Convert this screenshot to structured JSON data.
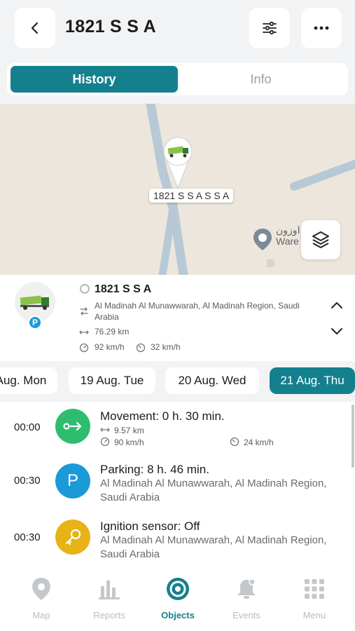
{
  "header": {
    "title": "1821 S S A",
    "back_icon": "chevron-left-icon",
    "filter_icon": "sliders-icon",
    "more_icon": "more-horizontal-icon"
  },
  "tabs": [
    {
      "label": "History",
      "active": true
    },
    {
      "label": "Info",
      "active": false
    }
  ],
  "map": {
    "marker_label": "1821 S S A  S S A",
    "poi_text_line1": "اوزون",
    "poi_text_line2": "Ware",
    "layers_icon": "layers-icon"
  },
  "object_card": {
    "name": "1821 S S A",
    "address": "Al Madinah Al Munawwarah, Al Madinah Region, Saudi Arabia",
    "distance": "76.29 km",
    "max_speed": "92 km/h",
    "avg_speed": "32 km/h",
    "badge": "P"
  },
  "dates": [
    {
      "label": "Aug. Mon",
      "active": false
    },
    {
      "label": "19 Aug. Tue",
      "active": false
    },
    {
      "label": "20 Aug. Wed",
      "active": false
    },
    {
      "label": "21 Aug. Thu",
      "active": true
    }
  ],
  "events": [
    {
      "time": "00:00",
      "title": "Movement: 0 h. 30 min.",
      "distance": "9.57 km",
      "max_speed": "90 km/h",
      "avg_speed": "24 km/h",
      "icon": "movement-icon",
      "color": "#2ebd6e"
    },
    {
      "time": "00:30",
      "title": "Parking: 8 h. 46 min.",
      "address": "Al Madinah Al Munawwarah, Al Madinah Region, Saudi Arabia",
      "icon_text": "P",
      "icon": "parking-icon",
      "color": "#1b9ad8"
    },
    {
      "time": "00:30",
      "title": "Ignition sensor: Off",
      "address": "Al Madinah Al Munawwarah, Al Madinah Region, Saudi Arabia",
      "icon": "key-icon",
      "color": "#e8b316"
    }
  ],
  "nav": [
    {
      "label": "Map",
      "icon": "map-pin-icon",
      "active": false
    },
    {
      "label": "Reports",
      "icon": "bar-chart-icon",
      "active": false
    },
    {
      "label": "Objects",
      "icon": "objects-icon",
      "active": true
    },
    {
      "label": "Events",
      "icon": "bell-icon",
      "active": false
    },
    {
      "label": "Menu",
      "icon": "grid-icon",
      "active": false
    }
  ],
  "colors": {
    "accent": "#15808d",
    "background": "#f2f3f4",
    "map_bg": "#ece6dc",
    "road": "#b7c9d6"
  }
}
